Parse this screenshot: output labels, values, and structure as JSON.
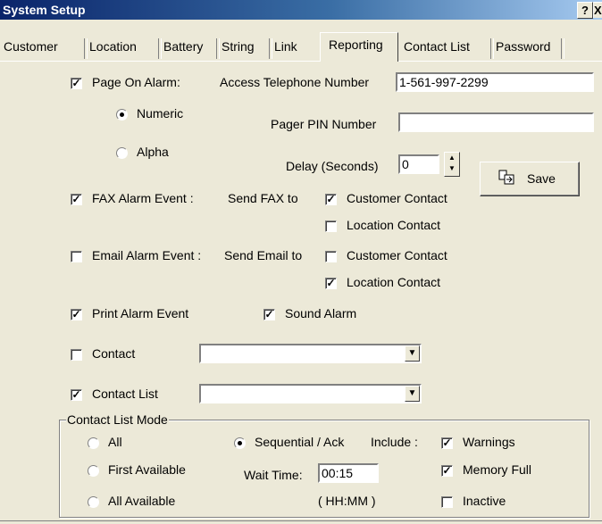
{
  "window": {
    "title": "System Setup",
    "help_label": "?",
    "close_label": "X"
  },
  "tabs": [
    {
      "label": "Customer"
    },
    {
      "label": "Location"
    },
    {
      "label": "Battery"
    },
    {
      "label": "String"
    },
    {
      "label": "Link"
    },
    {
      "label": "Reporting",
      "active": true
    },
    {
      "label": "Contact List"
    },
    {
      "label": "Password"
    }
  ],
  "page": {
    "page_on_alarm": {
      "label": "Page On Alarm:",
      "checked": true
    },
    "access_phone": {
      "label": "Access Telephone Number",
      "value": "1-561-997-2299"
    },
    "numeric": {
      "label": "Numeric",
      "selected": true
    },
    "alpha": {
      "label": "Alpha",
      "selected": false
    },
    "pager_pin": {
      "label": "Pager PIN Number",
      "value": ""
    },
    "delay": {
      "label": "Delay (Seconds)",
      "value": "0"
    },
    "save_label": "Save",
    "fax_alarm": {
      "label": "FAX Alarm Event :",
      "checked": true
    },
    "send_fax_to": "Send FAX to",
    "fax_customer_contact": {
      "label": "Customer Contact",
      "checked": true
    },
    "fax_location_contact": {
      "label": "Location Contact",
      "checked": false
    },
    "email_alarm": {
      "label": "Email Alarm Event :",
      "checked": false
    },
    "send_email_to": "Send Email to",
    "email_customer_contact": {
      "label": "Customer Contact",
      "checked": false
    },
    "email_location_contact": {
      "label": "Location Contact",
      "checked": true
    },
    "print_alarm": {
      "label": "Print Alarm Event",
      "checked": true
    },
    "sound_alarm": {
      "label": "Sound Alarm",
      "checked": true
    },
    "contact": {
      "label": "Contact",
      "checked": false,
      "value": ""
    },
    "contact_list": {
      "label": "Contact List",
      "checked": true,
      "value": ""
    }
  },
  "contact_list_mode": {
    "title": "Contact List Mode",
    "all": {
      "label": "All",
      "selected": false
    },
    "first_available": {
      "label": "First Available",
      "selected": false
    },
    "all_available": {
      "label": "All Available",
      "selected": false
    },
    "sequential_ack": {
      "label": "Sequential / Ack",
      "selected": true
    },
    "include_label": "Include :",
    "wait_time_label": "Wait Time:",
    "wait_time_value": "00:15",
    "wait_time_format": "( HH:MM )",
    "warnings": {
      "label": "Warnings",
      "checked": true
    },
    "memory_full": {
      "label": "Memory Full",
      "checked": true
    },
    "inactive": {
      "label": "Inactive",
      "checked": false
    }
  },
  "icons": {
    "check": "✓",
    "combo_arrow": "▼",
    "spin_up": "▲",
    "spin_down": "▼",
    "save": "save-icon"
  }
}
